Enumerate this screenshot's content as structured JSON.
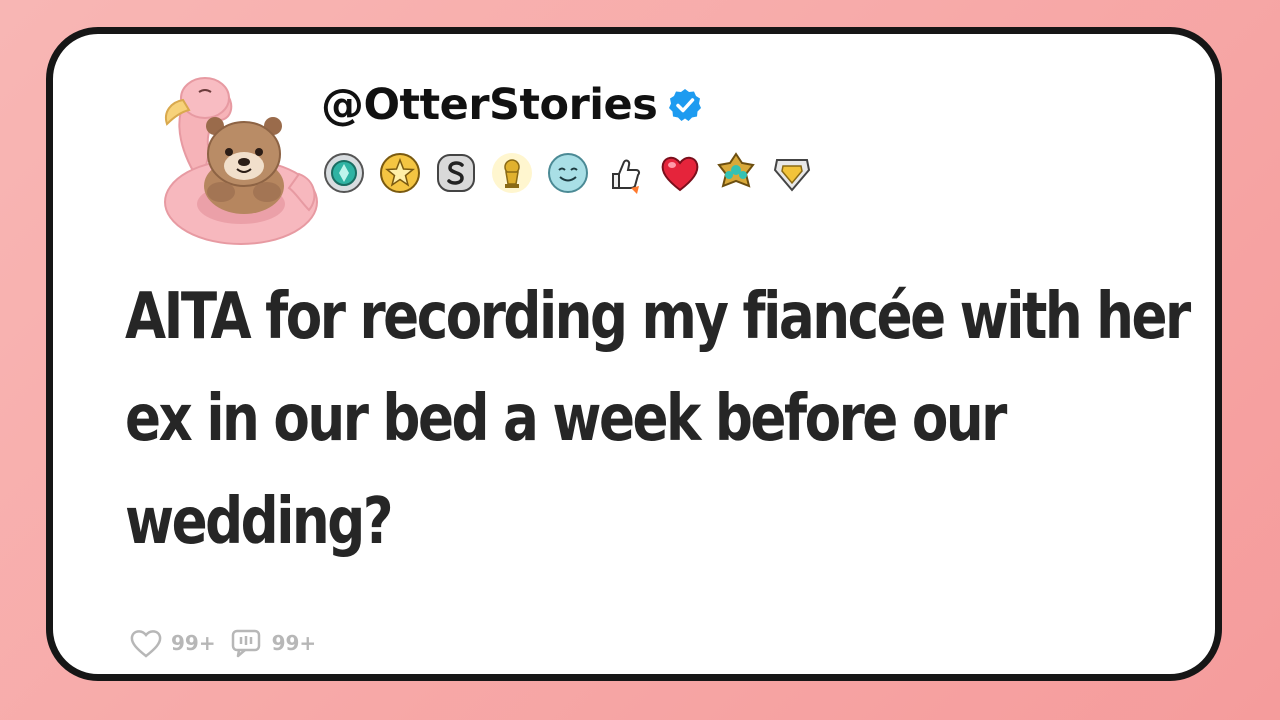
{
  "post": {
    "username": "@OtterStories",
    "verified": true,
    "avatar_icon": "otter-on-pink-flamingo-float-icon",
    "badges": [
      {
        "icon": "teal-gem-medal-icon"
      },
      {
        "icon": "gold-star-medal-icon"
      },
      {
        "icon": "silver-s-medal-icon"
      },
      {
        "icon": "gold-trophy-icon"
      },
      {
        "icon": "smiling-face-icon"
      },
      {
        "icon": "thumbs-up-rocket-icon"
      },
      {
        "icon": "red-heart-icon"
      },
      {
        "icon": "gold-gem-cluster-icon"
      },
      {
        "icon": "gold-diamond-shield-icon"
      }
    ],
    "title": "AITA for recording my fiancée with her ex in our bed a week before our wedding?",
    "likes": "99+",
    "comments": "99+"
  },
  "colors": {
    "background": "#f7a9a8",
    "card": "#ffffff",
    "border": "#161616",
    "verified": "#1d9bf0",
    "stats": "#b7b7b7"
  }
}
